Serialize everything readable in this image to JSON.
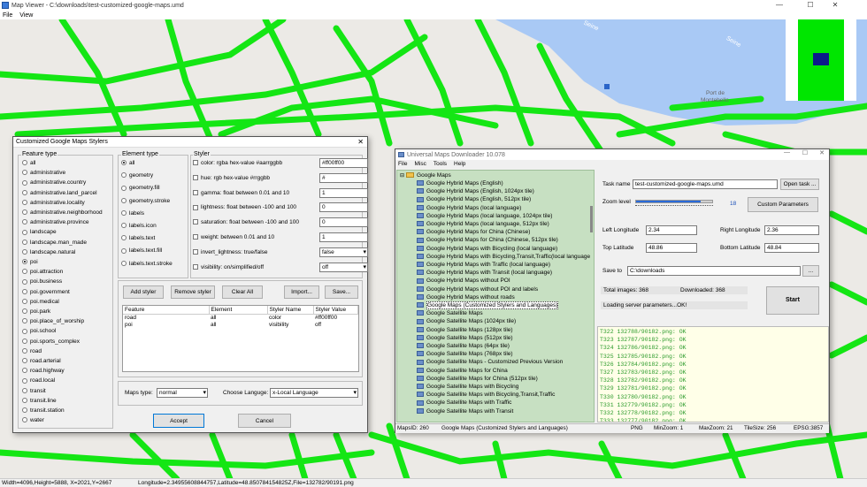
{
  "window": {
    "title": "Map Viewer - C:\\downloads\\test-customized-google-maps.umd",
    "menu": [
      "File",
      "View"
    ],
    "controls": [
      "—",
      "☐",
      "✕"
    ]
  },
  "map": {
    "labels": [
      {
        "text": "Seine",
        "name": "river-label-1"
      },
      {
        "text": "Seine",
        "name": "river-label-2"
      },
      {
        "text": "Port de",
        "name": "place-label-1"
      },
      {
        "text": "Montebello",
        "name": "place-label-2"
      }
    ],
    "colors": {
      "roads": "#14e614",
      "river": "#a9c9f5",
      "land": "#eceae6",
      "overview_square": "#0b1a8a"
    }
  },
  "status_bar": {
    "size": "Width=4096,Height=5888, X=2021,Y=2667",
    "coords": "Longitude=2.34955608844757,Latitude=48.850784154825Z,File=132782/90191.png"
  },
  "stylers_dialog": {
    "title": "Customized Google Maps Stylers",
    "close": "✕",
    "feature_type": {
      "label": "Feature type",
      "selected": "poi",
      "items": [
        "all",
        "administrative",
        "administrative.country",
        "administrative.land_parcel",
        "administrative.locality",
        "administrative.neighborhood",
        "administrative.province",
        "landscape",
        "landscape.man_made",
        "landscape.natural",
        "poi",
        "poi.attraction",
        "poi.business",
        "poi.government",
        "poi.medical",
        "poi.park",
        "poi.place_of_worship",
        "poi.school",
        "poi.sports_complex",
        "road",
        "road.arterial",
        "road.highway",
        "road.local",
        "transit",
        "transit.line",
        "transit.station",
        "water"
      ]
    },
    "element_type": {
      "label": "Element type",
      "selected": "all",
      "items": [
        "all",
        "geometry",
        "geometry.fill",
        "geometry.stroke",
        "labels",
        "labels.icon",
        "labels.text",
        "labels.text.fill",
        "labels.text.stroke"
      ]
    },
    "styler": {
      "label": "Styler",
      "rows": [
        {
          "label": "color: rgba hex-value #aarrggbb",
          "value": "#ff00ff00",
          "combo": false
        },
        {
          "label": "hue: rgb hex-value #rrggbb",
          "value": "#",
          "combo": false
        },
        {
          "label": "gamma: float between 0.01 and 10",
          "value": "1",
          "combo": false
        },
        {
          "label": "lightness: float between -100 and 100",
          "value": "0",
          "combo": false
        },
        {
          "label": "saturation: float between -100 and 100",
          "value": "0",
          "combo": false
        },
        {
          "label": "weight: between 0.01 and  10",
          "value": "1",
          "combo": false
        },
        {
          "label": "invert_lightness: true/false",
          "value": "false",
          "combo": true
        },
        {
          "label": "visibility: on/simplified/off",
          "value": "off",
          "combo": true
        }
      ]
    },
    "buttons": {
      "add": "Add styler",
      "remove": "Remove styler",
      "clear": "Clear All",
      "import": "Import...",
      "save": "Save..."
    },
    "table": {
      "headers": [
        "Feature",
        "Element",
        "Styler Name",
        "Styler Value"
      ],
      "rows": [
        [
          "road",
          "all",
          "color",
          "#ff00ff00"
        ],
        [
          "poi",
          "all",
          "visibility",
          "off"
        ]
      ]
    },
    "maps_type": {
      "label": "Maps type:",
      "value": "normal"
    },
    "language": {
      "label": "Choose Languge:",
      "value": "x-Local Language"
    },
    "accept": "Accept",
    "cancel": "Cancel"
  },
  "downloader": {
    "title": "Universal Maps Downloader 10.078",
    "menu": [
      "File",
      "Misc",
      "Tools",
      "Help"
    ],
    "tree_root": "Google Maps",
    "tree_items": [
      "Google Hybrid Maps (English)",
      "Google Hybrid Maps (English, 1024px tile)",
      "Google Hybrid Maps (English, 512px tile)",
      "Google Hybrid Maps (local language)",
      "Google Hybrid Maps (local language, 1024px tile)",
      "Google Hybrid Maps (local language, 512px tile)",
      "Google Hybrid Maps for China (Chinese)",
      "Google Hybrid Maps for China (Chinese, 512px tile)",
      "Google Hybrid Maps with Bicycling (local language)",
      "Google Hybrid Maps with Bicycling,Transit,Traffic(local language",
      "Google Hybrid Maps with Traffic (local language)",
      "Google Hybrid Maps with Transit (local language)",
      "Google Hybrid Maps without POI",
      "Google Hybrid Maps without POI and labels",
      "Google Hybrid Maps without roads",
      "Google Maps (Customized Stylers and Languages)",
      "Google Satellite Maps",
      "Google Satellite Maps (1024px tile)",
      "Google Satellite Maps (128px tile)",
      "Google Satellite Maps (512px tile)",
      "Google Satellite Maps (64px tile)",
      "Google Satellite Maps (768px tile)",
      "Google Satellite Maps - Customized Previous Version",
      "Google Satellite Maps for China",
      "Google Satellite Maps for China (512px tile)",
      "Google Satellite Maps with Bicycling",
      "Google Satellite Maps with Bicycling,Transit,Traffic",
      "Google Satellite Maps with Traffic",
      "Google Satellite Maps with Transit"
    ],
    "selected_index": 15,
    "task_name": {
      "label": "Task name",
      "value": "test-customized-google-maps.umd",
      "open": "Open task ..."
    },
    "zoom": {
      "label": "Zoom level",
      "value": "18",
      "fraction": 0.85
    },
    "custom_params": "Custom Parameters",
    "left_lon": {
      "label": "Left Longitude",
      "value": "2.34"
    },
    "right_lon": {
      "label": "Right Longitude",
      "value": "2.36"
    },
    "top_lat": {
      "label": "Top Latitude",
      "value": "48.86"
    },
    "bottom_lat": {
      "label": "Bottom Latitude",
      "value": "48.84"
    },
    "save_to": {
      "label": "Save to",
      "value": "C:\\downloads",
      "browse": "..."
    },
    "total": "Total images: 368",
    "downloaded": "Downloaded: 368",
    "status": "Loading server parameters...OK!",
    "start": "Start",
    "log": [
      "T322 132788/90182.png: OK",
      "T323 132787/90182.png: OK",
      "T324 132786/90182.png: OK",
      "T325 132785/90182.png: OK",
      "T326 132784/90182.png: OK",
      "T327 132783/90182.png: OK",
      "T328 132782/90182.png: OK",
      "T329 132781/90182.png: OK",
      "T330 132780/90182.png: OK",
      "T331 132779/90182.png: OK",
      "T332 132778/90182.png: OK",
      "T333 132777/90182.png: OK",
      "T334 132776/90182.png: OK"
    ],
    "statusbar": [
      "MapsID: 260",
      "Google Maps (Customized Stylers and Languages)",
      "PNG",
      "MinZoom: 1",
      "MaxZoom: 21",
      "TileSize: 256",
      "EPSG:3857"
    ]
  }
}
